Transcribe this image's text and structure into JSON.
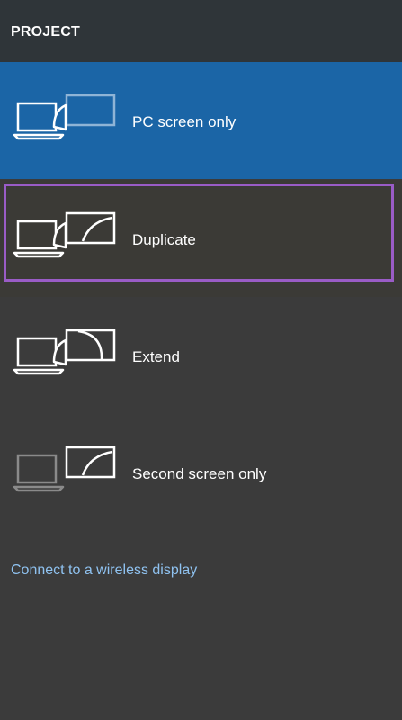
{
  "header": {
    "title": "PROJECT"
  },
  "options": [
    {
      "label": "PC screen only",
      "icon": "pc-screen-only-icon",
      "state": "selected"
    },
    {
      "label": "Duplicate",
      "icon": "duplicate-icon",
      "state": "focused"
    },
    {
      "label": "Extend",
      "icon": "extend-icon",
      "state": "normal"
    },
    {
      "label": "Second screen only",
      "icon": "second-screen-only-icon",
      "state": "normal"
    }
  ],
  "wireless_link": {
    "label": "Connect to a wireless display"
  },
  "colors": {
    "panel_bg": "#3b3b3b",
    "header_bg": "#2f3539",
    "selected_bg": "#1b65a6",
    "focus_ring": "#9a5cc6",
    "link": "#8fc2f0"
  }
}
